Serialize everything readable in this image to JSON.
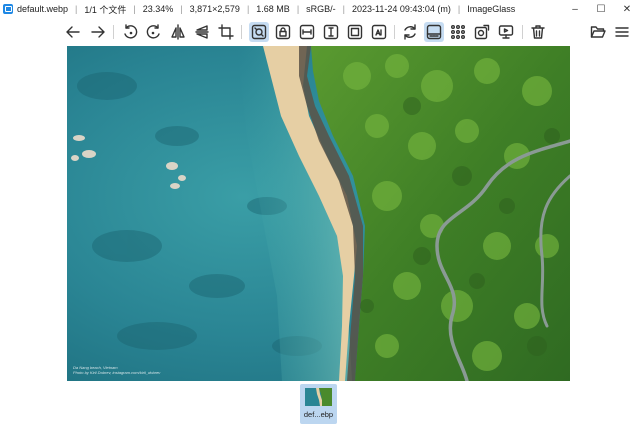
{
  "titlebar": {
    "filename": "default.webp",
    "index": "1/1 个文件",
    "zoom": "23.34%",
    "dimensions": "3,871×2,579",
    "filesize": "1.68 MB",
    "colorprofile": "sRGB/-",
    "datetime": "2023-11-24 09:43:04 (m)",
    "app_name": "ImageGlass"
  },
  "window_controls": {
    "minimize": "–",
    "maximize": "☐",
    "close": "✕"
  },
  "toolbar": {
    "active_buttons": [
      "zoom-to-fit",
      "toggle-thumbnail-bar"
    ],
    "icons": [
      "arrow-left-icon",
      "arrow-right-icon",
      "rotate-left-icon",
      "rotate-right-icon",
      "flip-horizontal-icon",
      "flip-vertical-icon",
      "crop-icon",
      "zoom-to-fit-icon",
      "lock-zoom-icon",
      "scale-to-width-icon",
      "scale-to-height-icon",
      "scale-to-fill-icon",
      "refresh-icon",
      "thumbnail-bar-icon",
      "checkerboard-icon",
      "gallery-icon",
      "slideshow-icon",
      "delete-icon",
      "open-folder-icon",
      "menu-icon"
    ]
  },
  "image": {
    "caption_line1": "Da Nang beach, Vietnam",
    "caption_line2": "Photo by Kiril Dobrev, instagram.com/kiril_dobrev"
  },
  "thumbnail": {
    "label": "def...ebp"
  }
}
